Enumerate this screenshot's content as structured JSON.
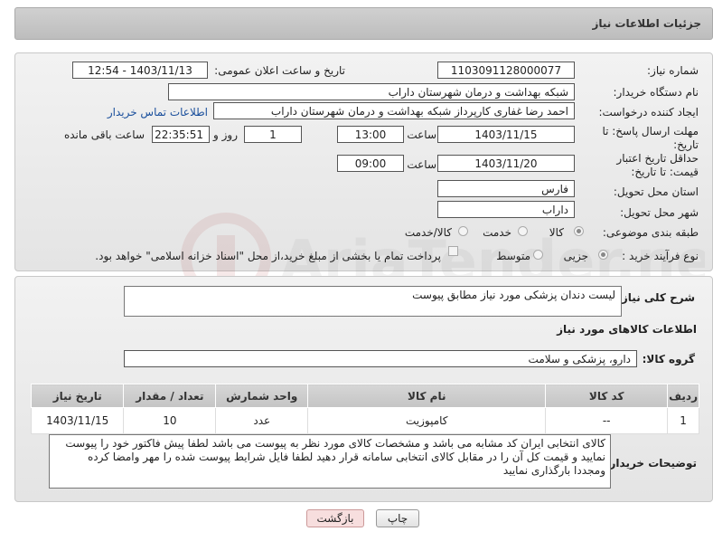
{
  "header": {
    "title": "جزئیات اطلاعات نیاز"
  },
  "form": {
    "need_number_label": "شماره نیاز:",
    "need_number": "1103091128000077",
    "announce_label": "تاریخ و ساعت اعلان عمومی:",
    "announce_value": "1403/11/13 - 12:54",
    "buyer_org_label": "نام دستگاه خریدار:",
    "buyer_org": "شبکه بهداشت و درمان شهرستان داراب",
    "creator_label": "ایجاد کننده درخواست:",
    "creator": "احمد رضا غفاری کارپرداز شبکه بهداشت و درمان شهرستان داراب",
    "contact_link": "اطلاعات تماس خریدار",
    "deadline_label": "مهلت ارسال پاسخ: تا تاریخ:",
    "deadline_date": "1403/11/15",
    "time_label": "ساعت",
    "deadline_time": "13:00",
    "days_value": "1",
    "days_label": "روز و",
    "remaining_time": "22:35:51",
    "remaining_label": "ساعت باقی مانده",
    "validity_label": "حداقل تاریخ اعتبار قیمت: تا تاریخ:",
    "validity_date": "1403/11/20",
    "validity_time": "09:00",
    "province_label": "استان محل تحویل:",
    "province": "فارس",
    "city_label": "شهر محل تحویل:",
    "city": "داراب",
    "category_label": "طبقه بندی موضوعی:",
    "category_options": [
      "کالا",
      "خدمت",
      "کالا/خدمت"
    ],
    "category_selected": "کالا",
    "process_label": "نوع فرآیند خرید :",
    "process_options": [
      "جزیی",
      "متوسط"
    ],
    "process_selected": "جزیی",
    "payment_note": "پرداخت تمام یا بخشی از مبلغ خرید،از محل \"اسناد خزانه اسلامی\" خواهد بود."
  },
  "details": {
    "description_label": "شرح کلی نیاز:",
    "description": "لیست دندان پزشکی مورد نیاز مطابق پیوست",
    "goods_info_title": "اطلاعات کالاهای مورد نیاز",
    "goods_group_label": "گروه کالا:",
    "goods_group": "دارو، پزشکی و سلامت",
    "table": {
      "headers": [
        "ردیف",
        "کد کالا",
        "نام کالا",
        "واحد شمارش",
        "تعداد / مقدار",
        "تاریخ نیاز"
      ],
      "rows": [
        [
          "1",
          "--",
          "کامپوزیت",
          "عدد",
          "10",
          "1403/11/15"
        ]
      ]
    },
    "buyer_notes_label": "توضیحات خریدار:",
    "buyer_notes": "کالای انتخابی ایران کد مشابه می باشد و مشخصات کالای مورد نظر به پیوست می باشد لطفا پیش فاکتور خود را پیوست نمایید و قیمت کل آن را در مقابل کالای انتخابی سامانه قرار دهید لطفا فایل شرایط پیوست شده را مهر وامضا کرده ومجددا بارگذاری نمایید"
  },
  "buttons": {
    "print": "چاپ",
    "back": "بازگشت"
  },
  "colors": {
    "link": "#1a4f9c",
    "header_bg": "#c8c8c8",
    "back_button_bg": "#f7dede"
  }
}
